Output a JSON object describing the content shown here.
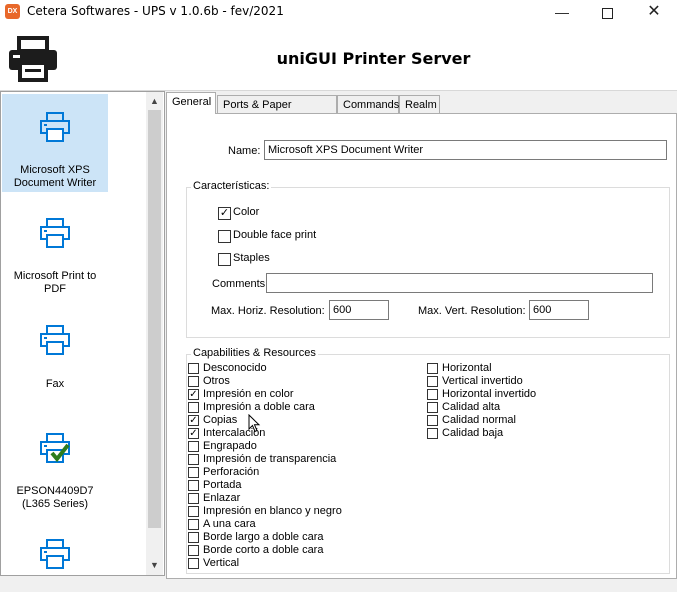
{
  "window": {
    "title": "Cetera Softwares - UPS v 1.0.6b - fev/2021",
    "icon_label": "DX"
  },
  "header": {
    "title": "uniGUI Printer Server"
  },
  "printers": [
    {
      "label": "Microsoft XPS Document Writer",
      "selected": true,
      "default": false
    },
    {
      "label": "Microsoft Print to PDF",
      "selected": false,
      "default": false
    },
    {
      "label": "Fax",
      "selected": false,
      "default": false
    },
    {
      "label": "EPSON4409D7 (L365 Series)",
      "selected": false,
      "default": true
    },
    {
      "label": "",
      "selected": false,
      "default": false
    }
  ],
  "tabs": [
    "General",
    "Ports & Paper Formats",
    "Commands",
    "Realm"
  ],
  "active_tab": "General",
  "general": {
    "name_label": "Name:",
    "name_value": "Microsoft XPS Document Writer",
    "caracteristicas_title": "Características:",
    "color_label": "Color",
    "color_checked": true,
    "double_face_label": "Double face print",
    "double_face_checked": false,
    "staples_label": "Staples",
    "staples_checked": false,
    "comments_label": "Comments",
    "comments_value": "",
    "max_horiz_label": "Max.  Horiz. Resolution:",
    "max_horiz_value": "600",
    "max_vert_label": "Max. Vert. Resolution:",
    "max_vert_value": "600"
  },
  "capabilities": {
    "title": "Capabilities & Resources",
    "left": [
      {
        "label": "Desconocido",
        "checked": false
      },
      {
        "label": "Otros",
        "checked": false
      },
      {
        "label": "Impresión en color",
        "checked": true
      },
      {
        "label": "Impresión a doble cara",
        "checked": false
      },
      {
        "label": "Copias",
        "checked": true
      },
      {
        "label": "Intercalación",
        "checked": true
      },
      {
        "label": "Engrapado",
        "checked": false
      },
      {
        "label": "Impresión de transparencia",
        "checked": false
      },
      {
        "label": "Perforación",
        "checked": false
      },
      {
        "label": "Portada",
        "checked": false
      },
      {
        "label": "Enlazar",
        "checked": false
      },
      {
        "label": "Impresión en blanco y negro",
        "checked": false
      },
      {
        "label": "A una cara",
        "checked": false
      },
      {
        "label": "Borde largo a doble cara",
        "checked": false
      },
      {
        "label": "Borde corto a doble cara",
        "checked": false
      },
      {
        "label": "Vertical",
        "checked": false
      }
    ],
    "right": [
      {
        "label": "Horizontal",
        "checked": false
      },
      {
        "label": "Vertical invertido",
        "checked": false
      },
      {
        "label": "Horizontal invertido",
        "checked": false
      },
      {
        "label": "Calidad alta",
        "checked": false
      },
      {
        "label": "Calidad normal",
        "checked": false
      },
      {
        "label": "Calidad baja",
        "checked": false
      }
    ]
  },
  "colors": {
    "selection": "#cce4f7",
    "printer_icon": "#0078d7",
    "default_check": "#2e7d1e"
  }
}
